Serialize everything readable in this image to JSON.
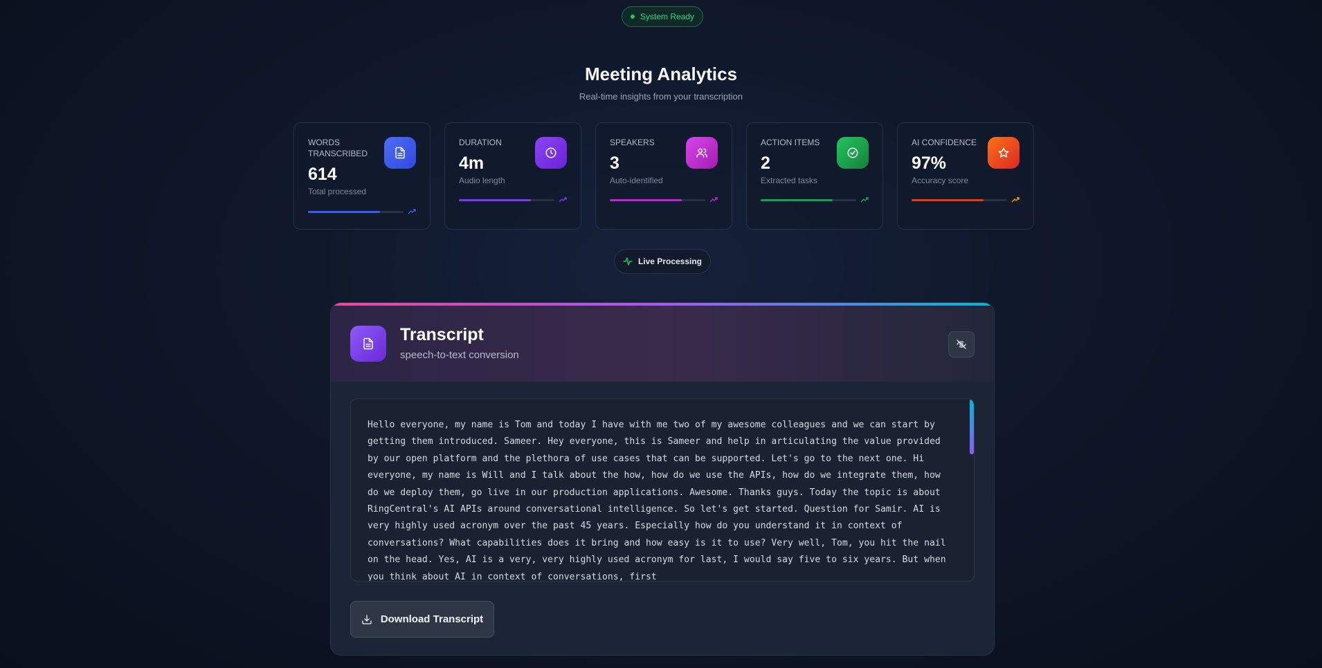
{
  "status": {
    "label": "System Ready",
    "color": "#22c55e"
  },
  "header": {
    "title": "Meeting Analytics",
    "subtitle": "Real-time insights from your transcription"
  },
  "stats": [
    {
      "label": "WORDS TRANSCRIBED",
      "value": "614",
      "sub": "Total processed",
      "icon": "document-icon",
      "accent": "#3b5bf6",
      "progress": 0.75
    },
    {
      "label": "DURATION",
      "value": "4m",
      "sub": "Audio length",
      "icon": "clock-icon",
      "accent": "#7c3aed",
      "progress": 0.75
    },
    {
      "label": "SPEAKERS",
      "value": "3",
      "sub": "Auto-identified",
      "icon": "users-icon",
      "accent": "#c026d3",
      "progress": 0.75
    },
    {
      "label": "ACTION ITEMS",
      "value": "2",
      "sub": "Extracted tasks",
      "icon": "check-circle-icon",
      "accent": "#16a34a",
      "progress": 0.75
    },
    {
      "label": "AI CONFIDENCE",
      "value": "97%",
      "sub": "Accuracy score",
      "icon": "star-icon",
      "accent": "#ea3a12",
      "progress": 0.75
    }
  ],
  "live": {
    "label": "Live Processing"
  },
  "transcript": {
    "title": "Transcript",
    "subtitle": "speech-to-text conversion",
    "text": "Hello everyone, my name is Tom and today I have with me two of my awesome colleagues and we can start by getting them introduced. Sameer. Hey everyone, this is Sameer and help in articulating the value provided by our open platform and the plethora of use cases that can be supported. Let's go to the next one. Hi everyone, my name is Will and I talk about the how, how do we use the APIs, how do we integrate them, how do we deploy them, go live in our production applications. Awesome. Thanks guys. Today the topic is about RingCentral's AI APIs around conversational intelligence. So let's get started. Question for Samir. AI is very highly used acronym over the past 45 years. Especially how do you understand it in context of conversations? What capabilities does it bring and how easy is it to use? Very well, Tom, you hit the nail on the head. Yes, AI is a very, very highly used acronym for last, I would say five to six years. But when you think about AI in context of conversations, first",
    "download_label": "Download Transcript"
  }
}
